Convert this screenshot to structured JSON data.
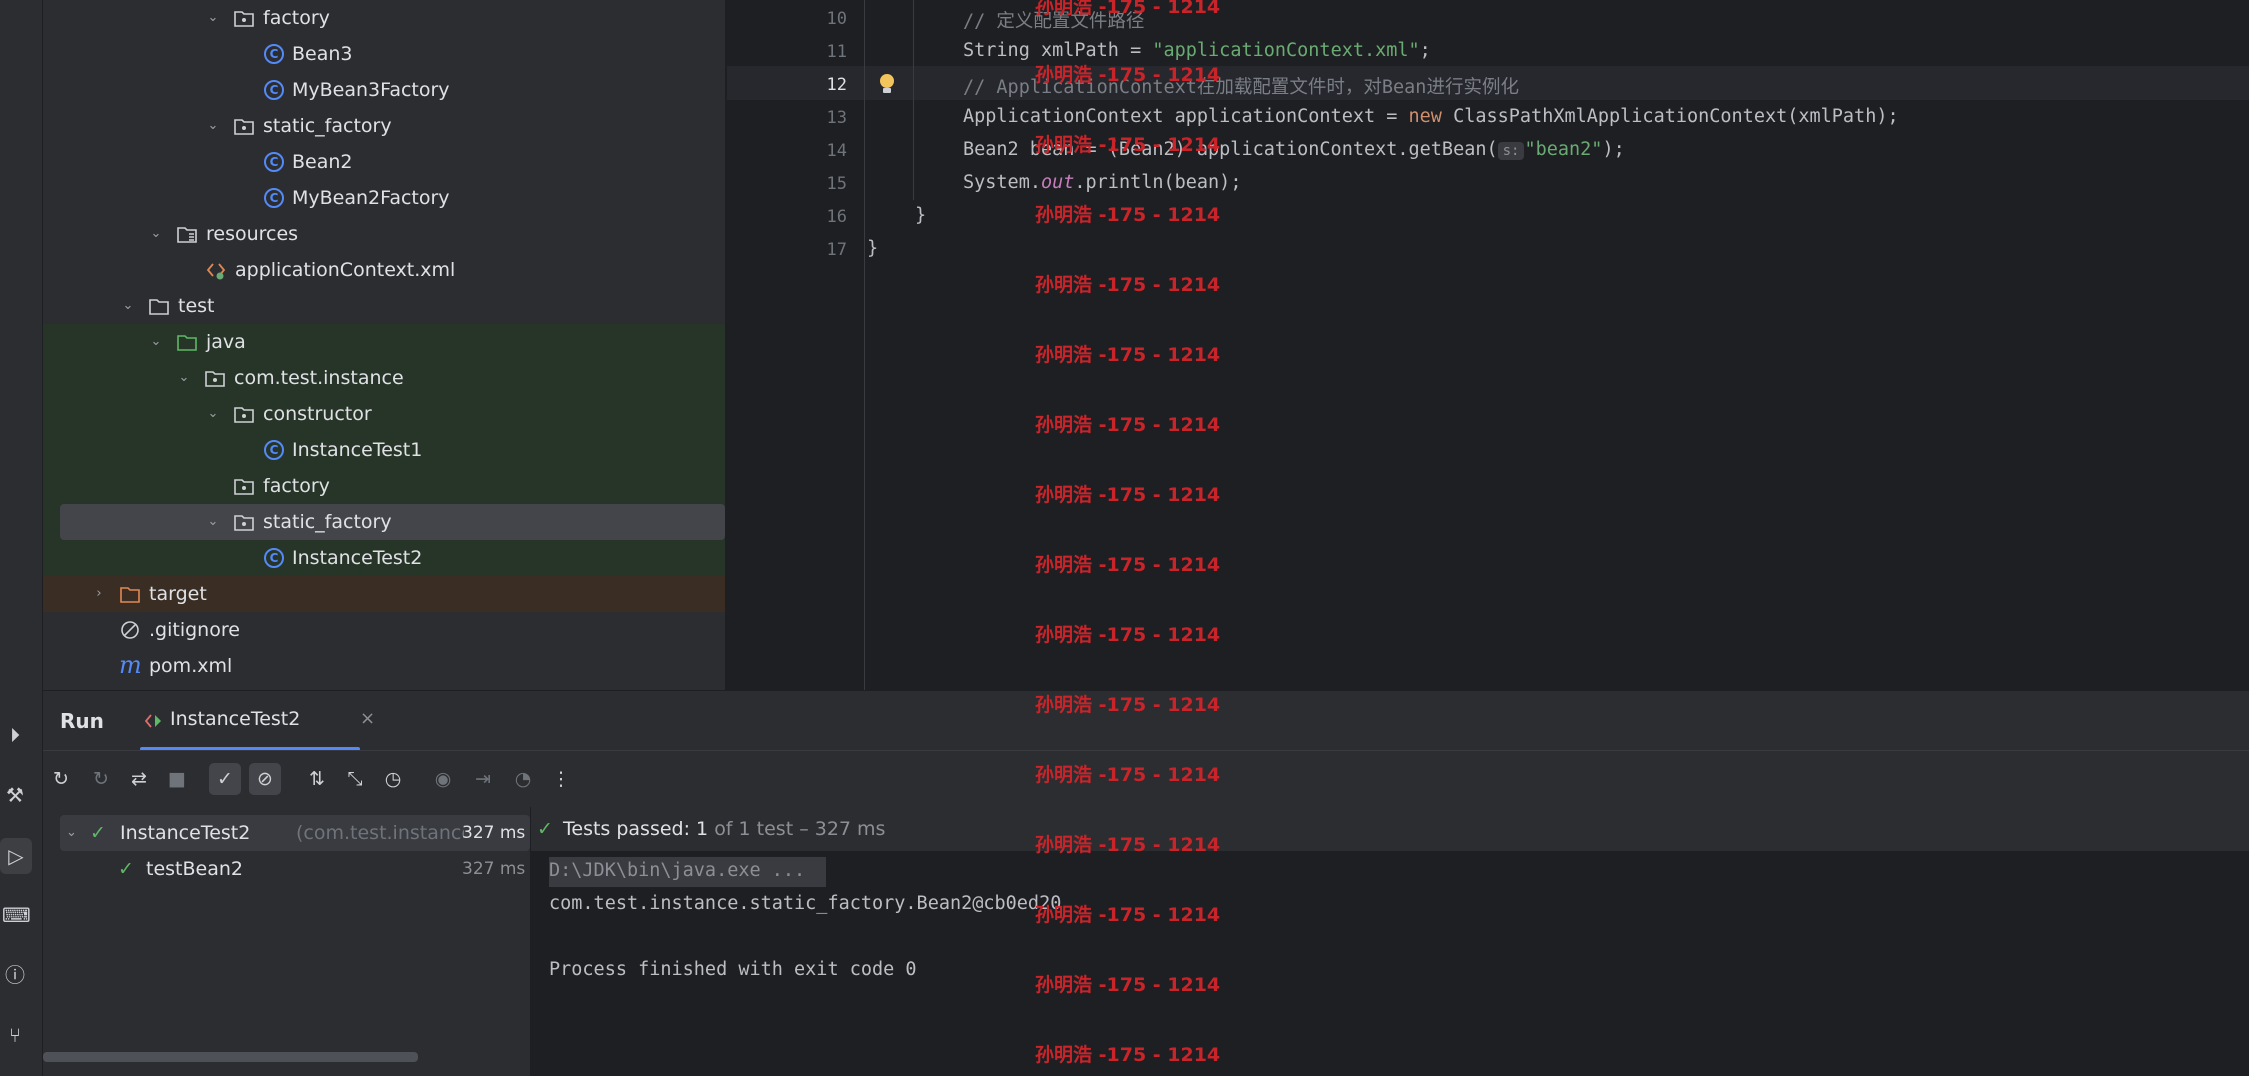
{
  "tree": {
    "items": [
      {
        "label": "factory",
        "type": "package",
        "expanded": true
      },
      {
        "label": "Bean3",
        "type": "class"
      },
      {
        "label": "MyBean3Factory",
        "type": "class"
      },
      {
        "label": "static_factory",
        "type": "package",
        "expanded": true
      },
      {
        "label": "Bean2",
        "type": "class"
      },
      {
        "label": "MyBean2Factory",
        "type": "class"
      },
      {
        "label": "resources",
        "type": "resources",
        "expanded": true
      },
      {
        "label": "applicationContext.xml",
        "type": "xml"
      },
      {
        "label": "test",
        "type": "folder",
        "expanded": true
      },
      {
        "label": "java",
        "type": "test-root",
        "expanded": true
      },
      {
        "label": "com.test.instance",
        "type": "package",
        "expanded": true
      },
      {
        "label": "constructor",
        "type": "package",
        "expanded": true
      },
      {
        "label": "InstanceTest1",
        "type": "class"
      },
      {
        "label": "factory",
        "type": "package"
      },
      {
        "label": "static_factory",
        "type": "package",
        "expanded": true,
        "selected": true
      },
      {
        "label": "InstanceTest2",
        "type": "class"
      },
      {
        "label": "target",
        "type": "folder",
        "expanded": false
      },
      {
        "label": ".gitignore",
        "type": "ignore"
      },
      {
        "label": "pom.xml",
        "type": "maven"
      }
    ]
  },
  "editor": {
    "line_numbers": [
      "10",
      "11",
      "12",
      "13",
      "14",
      "15",
      "16",
      "17"
    ],
    "current_line": "12",
    "lines": {
      "l10": "// 定义配置文件路径",
      "l11_a": "String xmlPath = ",
      "l11_b": "\"applicationContext.xml\"",
      "l11_c": ";",
      "l12": "// ApplicationContext在加载配置文件时，对Bean进行实例化",
      "l13_a": "ApplicationContext applicationContext = ",
      "l13_b": "new",
      "l13_c": " ClassPathXmlApplicationContext(xmlPath);",
      "l14_a": "Bean2 bean = (Bean2) applicationContext.getBean(",
      "l14_hint": "s:",
      "l14_b": "\"bean2\"",
      "l14_c": ");",
      "l15_a": "System.",
      "l15_b": "out",
      "l15_c": ".println(bean);",
      "l16": "}",
      "l17": "}"
    }
  },
  "watermark": "孙明浩 -175 - 1214",
  "run": {
    "title": "Run",
    "tab_label": "InstanceTest2",
    "tests": [
      {
        "name": "InstanceTest2",
        "detail": "(com.test.instance.s",
        "time": "327 ms"
      },
      {
        "name": "testBean2",
        "detail": "",
        "time": "327 ms"
      }
    ],
    "status_prefix": "Tests passed: ",
    "status_count": "1",
    "status_rest": "of 1 test – 327 ms",
    "console": [
      "D:\\JDK\\bin\\java.exe ...",
      "com.test.instance.static_factory.Bean2@cb0ed20",
      "",
      "Process finished with exit code 0"
    ]
  },
  "colors": {
    "accent": "#548af7",
    "pass": "#5fb865",
    "watermark": "#c8242a",
    "string": "#6aab73",
    "keyword": "#cf8e6d"
  }
}
